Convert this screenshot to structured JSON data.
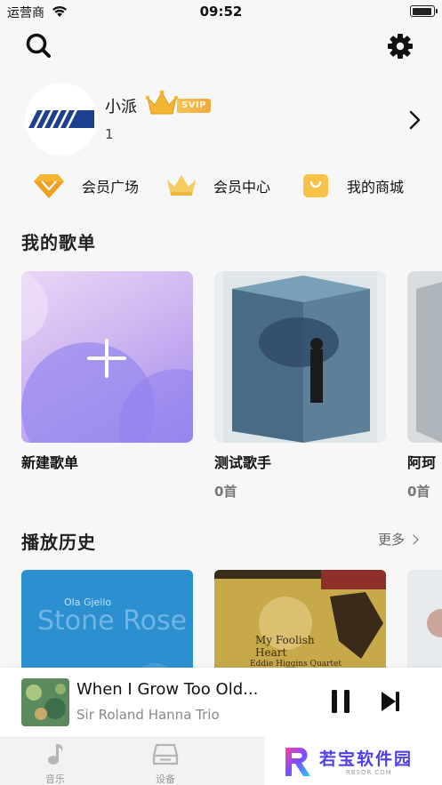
{
  "status_bar": {
    "carrier": "运营商",
    "time": "09:52"
  },
  "profile": {
    "name": "小派",
    "badge": "SVIP",
    "sub": "1"
  },
  "quick_links": [
    {
      "label": "会员广场",
      "icon": "diamond-icon"
    },
    {
      "label": "会员中心",
      "icon": "crown-icon"
    },
    {
      "label": "我的商城",
      "icon": "shopping-bag-icon"
    }
  ],
  "playlists": {
    "title": "我的歌单",
    "items": [
      {
        "label": "新建歌单"
      },
      {
        "label": "测试歌手",
        "count": "0首"
      },
      {
        "label": "阿珂",
        "count": "0首"
      }
    ]
  },
  "history": {
    "title": "播放历史",
    "more": "更多",
    "items": [
      {
        "cover_caption": "Ola Gjeilo",
        "cover_title": "Stone Rose"
      },
      {
        "cover_title": "My Foolish Heart",
        "cover_caption": "Eddie Higgins Quartet"
      },
      {}
    ]
  },
  "player": {
    "title": "When I Grow Too Old...",
    "artist": "Sir Roland Hanna Trio"
  },
  "tabs": [
    {
      "label": "音乐",
      "icon": "music-note-icon"
    },
    {
      "label": "设备",
      "icon": "device-icon"
    }
  ],
  "watermark": {
    "text": "若宝软件园",
    "sub": "RBSOR.COM"
  },
  "colors": {
    "accent_gold": "#f2b632",
    "new_card": "#a98ff0",
    "text": "#222222"
  }
}
